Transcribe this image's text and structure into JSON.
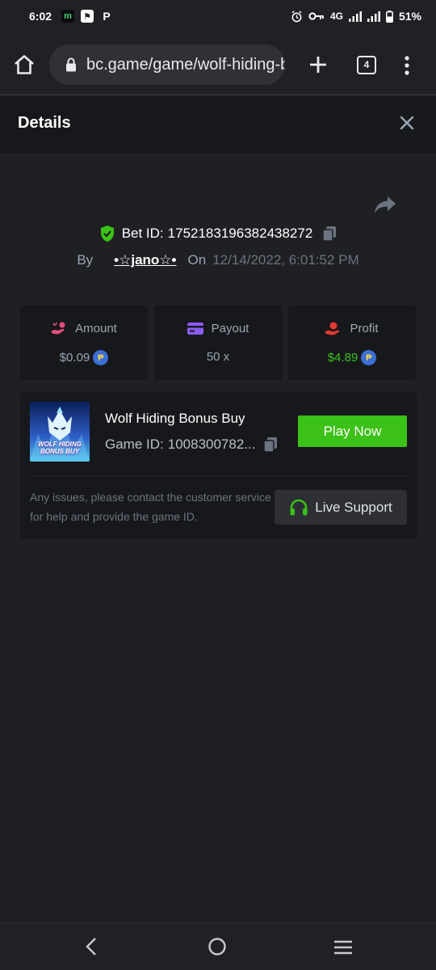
{
  "status_bar": {
    "time": "6:02",
    "app_icons": [
      "m",
      "⚑",
      "P"
    ],
    "network": "4G",
    "battery": "51%"
  },
  "browser": {
    "url": "bc.game/game/wolf-hiding-bonus-buy",
    "tab_count": "4"
  },
  "details": {
    "title": "Details",
    "bet_label": "Bet ID:",
    "bet_id": "1752183196382438272",
    "by_label": "By",
    "username": "•☆jano☆•",
    "on_label": "On",
    "date": "12/14/2022, 6:01:52 PM"
  },
  "stats": {
    "amount": {
      "label": "Amount",
      "value": "$0.09"
    },
    "payout": {
      "label": "Payout",
      "value": "50 x"
    },
    "profit": {
      "label": "Profit",
      "value": "$4.89"
    }
  },
  "coin_symbol": "₱",
  "game": {
    "name": "Wolf Hiding Bonus Buy",
    "thumb_line1": "WOLF HIDING",
    "thumb_line2": "BONUS BUY",
    "game_id_label": "Game ID:",
    "game_id": "1008300782...",
    "play_label": "Play Now",
    "issues_text": "Any issues, please contact the customer service for help and provide the game ID.",
    "support_label": "Live Support"
  },
  "colors": {
    "accent_green": "#3bc117",
    "background": "#1f2023",
    "panel": "#17181b",
    "muted_text": "#98a7b5"
  }
}
